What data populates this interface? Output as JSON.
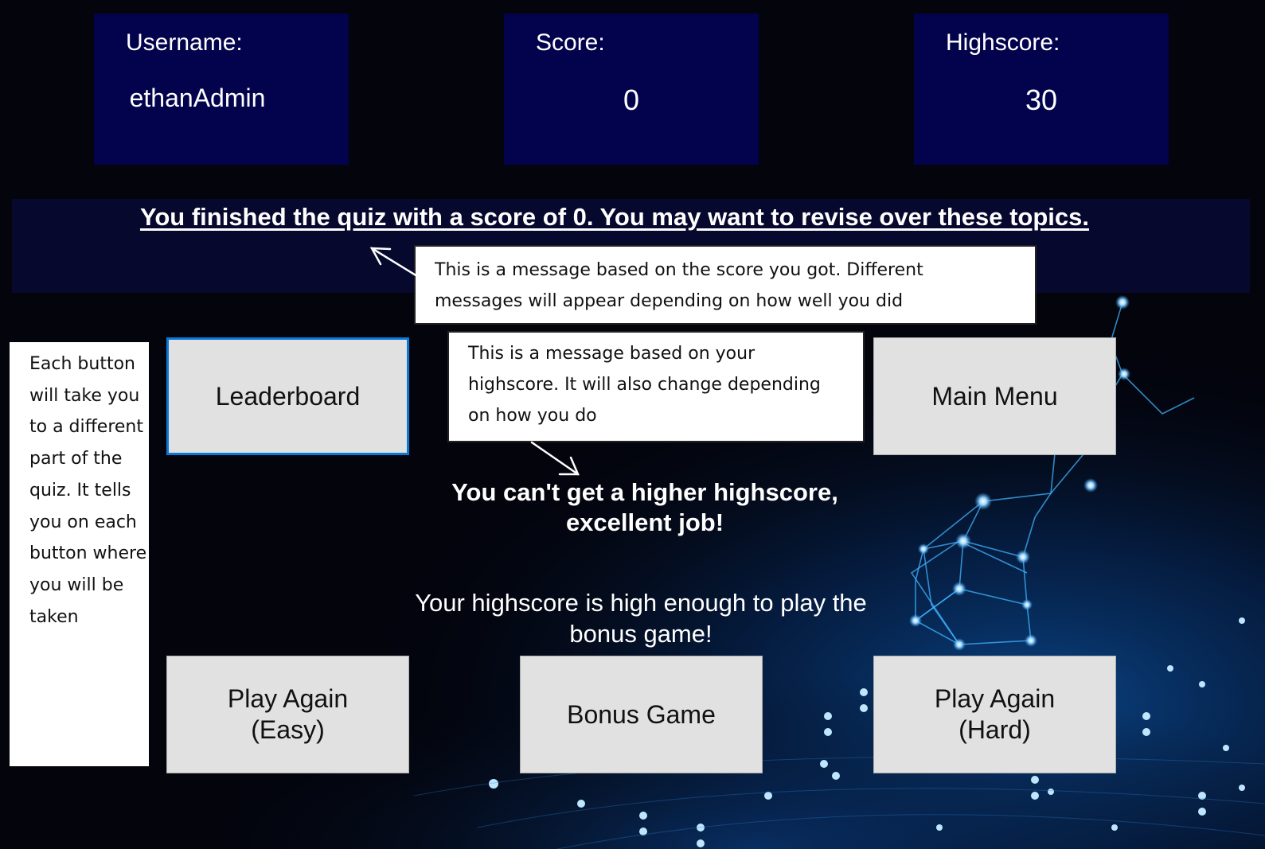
{
  "stats": {
    "username_label": "Username:",
    "username_value": "ethanAdmin",
    "score_label": "Score:",
    "score_value": "0",
    "highscore_label": "Highscore:",
    "highscore_value": "30"
  },
  "messages": {
    "score_message": "You finished the quiz with a score of 0. You may want to revise over these topics.",
    "highscore_message": "You can't get a higher highscore, excellent job!",
    "bonus_message": "Your highscore is high enough to play the bonus game!"
  },
  "buttons": {
    "leaderboard": "Leaderboard",
    "main_menu": "Main Menu",
    "play_again_easy_line1": "Play Again",
    "play_again_easy_line2": "(Easy)",
    "bonus_game": "Bonus Game",
    "play_again_hard_line1": "Play Again",
    "play_again_hard_line2": "(Hard)"
  },
  "callouts": {
    "score_callout": "This is a message based on the score you got. Different messages will appear depending on how well you did",
    "highscore_callout": "This is a message based on your highscore. It will also change depending on how you do",
    "buttons_callout": "Each button will take you to a different part of the quiz. It tells you on each button where you will be taken"
  },
  "colors": {
    "stat_box_bg": "#03034d",
    "button_bg": "#e1e1e1",
    "selected_button_border": "#0a78d7",
    "background": "#03040c",
    "network_glow": "#2fa8ff"
  }
}
